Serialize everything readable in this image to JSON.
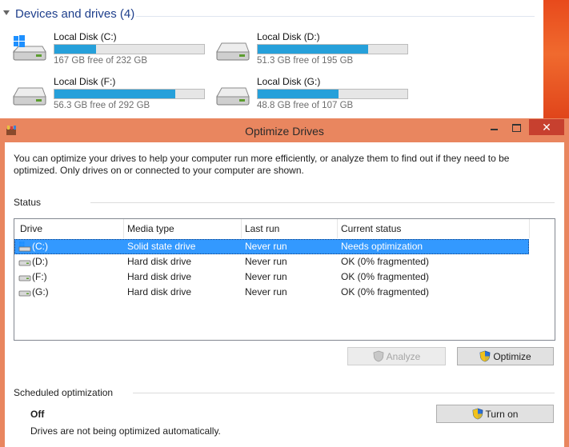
{
  "explorer": {
    "section_title": "Devices and drives (4)",
    "drives": [
      {
        "name": "Local Disk (C:)",
        "free_text": "167 GB free of 232 GB",
        "used_fraction": 0.28,
        "icon": "windows-drive-icon"
      },
      {
        "name": "Local Disk (D:)",
        "free_text": "51.3 GB free of 195 GB",
        "used_fraction": 0.74,
        "icon": "hard-disk-icon"
      },
      {
        "name": "Local Disk (F:)",
        "free_text": "56.3 GB free of 292 GB",
        "used_fraction": 0.81,
        "icon": "hard-disk-icon"
      },
      {
        "name": "Local Disk (G:)",
        "free_text": "48.8 GB free of 107 GB",
        "used_fraction": 0.54,
        "icon": "hard-disk-icon"
      }
    ]
  },
  "window": {
    "title": "Optimize Drives",
    "close_glyph": "✕",
    "intro": "You can optimize your drives to help your computer run more efficiently, or analyze them to find out if they need to be optimized. Only drives on or connected to your computer are shown.",
    "status_label": "Status",
    "columns": [
      "Drive",
      "Media type",
      "Last run",
      "Current status"
    ],
    "rows": [
      {
        "drive": "(C:)",
        "media": "Solid state drive",
        "last_run": "Never run",
        "status": "Needs optimization",
        "selected": true,
        "icon": "windows-drive-icon"
      },
      {
        "drive": "(D:)",
        "media": "Hard disk drive",
        "last_run": "Never run",
        "status": "OK (0% fragmented)",
        "selected": false,
        "icon": "hard-disk-icon"
      },
      {
        "drive": "(F:)",
        "media": "Hard disk drive",
        "last_run": "Never run",
        "status": "OK (0% fragmented)",
        "selected": false,
        "icon": "hard-disk-icon"
      },
      {
        "drive": "(G:)",
        "media": "Hard disk drive",
        "last_run": "Never run",
        "status": "OK (0% fragmented)",
        "selected": false,
        "icon": "hard-disk-icon"
      }
    ],
    "analyze_label": "Analyze",
    "optimize_label": "Optimize",
    "scheduled_label": "Scheduled optimization",
    "schedule_state": "Off",
    "schedule_desc": "Drives are not being optimized automatically.",
    "turn_on_label": "Turn on"
  },
  "colors": {
    "titlebar": "#e9865f",
    "close_button": "#c7402f",
    "selection": "#3399ff",
    "usage_bar": "#26a0da",
    "section_title": "#1e3f8c"
  }
}
